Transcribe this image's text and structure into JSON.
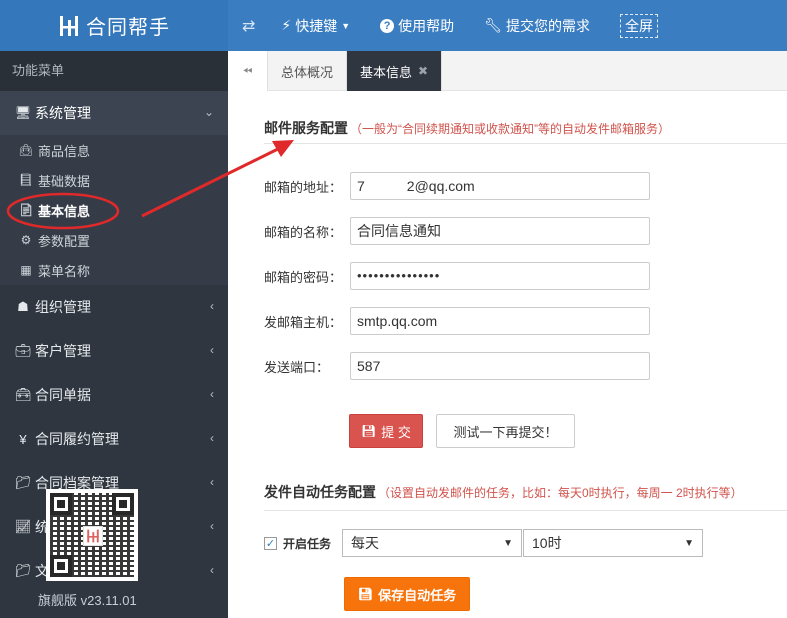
{
  "app": {
    "title": "合同帮手",
    "version": "旗舰版 v23.11.01"
  },
  "topnav": {
    "shortcut": "快捷键",
    "help": "使用帮助",
    "feedback": "提交您的需求",
    "fullscreen": "全屏"
  },
  "sidebar": {
    "title": "功能菜单",
    "groups": [
      {
        "label": "系统管理",
        "icon": "desktop-icon",
        "open": true,
        "items": [
          {
            "label": "商品信息",
            "icon": "bag-icon"
          },
          {
            "label": "基础数据",
            "icon": "book-icon"
          },
          {
            "label": "基本信息",
            "icon": "file-icon",
            "active": true
          },
          {
            "label": "参数配置",
            "icon": "gear-icon"
          },
          {
            "label": "菜单名称",
            "icon": "grid-icon"
          }
        ]
      },
      {
        "label": "组织管理",
        "icon": "sitemap-icon"
      },
      {
        "label": "客户管理",
        "icon": "briefcase-icon"
      },
      {
        "label": "合同单据",
        "icon": "suitcase-icon"
      },
      {
        "label": "合同履约管理",
        "icon": "yen-icon"
      },
      {
        "label": "合同档案管理",
        "icon": "folder-icon"
      },
      {
        "label": "统",
        "icon": "chart-icon"
      },
      {
        "label": "文",
        "icon": "folder-icon"
      }
    ]
  },
  "tabs": {
    "items": [
      {
        "label": "总体概况",
        "active": false
      },
      {
        "label": "基本信息",
        "active": true
      }
    ]
  },
  "mail_section": {
    "title": "邮件服务配置",
    "note": "（一般为“合同续期通知或收款通知”等的自动发件邮箱服务）",
    "fields": [
      {
        "label": "邮箱的地址：",
        "value": "7      2@qq.com"
      },
      {
        "label": "邮箱的名称：",
        "value": "合同信息通知"
      },
      {
        "label": "邮箱的密码：",
        "value": "•••••••••••••••"
      },
      {
        "label": "发邮箱主机：",
        "value": "smtp.qq.com"
      },
      {
        "label": "发送端口：",
        "value": "587"
      }
    ],
    "submit_label": "提 交",
    "test_label": "测试一下再提交！"
  },
  "task_section": {
    "title": "发件自动任务配置",
    "note": "（设置自动发邮件的任务，比如：每天0时执行，每周一 2时执行等）",
    "enable_label": "开启任务",
    "enabled": true,
    "frequency": "每天",
    "hour": "10时",
    "save_label": "保存自动任务"
  },
  "colors": {
    "topbar": "#3a7dc0",
    "sidebar": "#2f3640",
    "danger": "#d9534f",
    "warning": "#f7740c",
    "annotation": "#e0292a"
  }
}
